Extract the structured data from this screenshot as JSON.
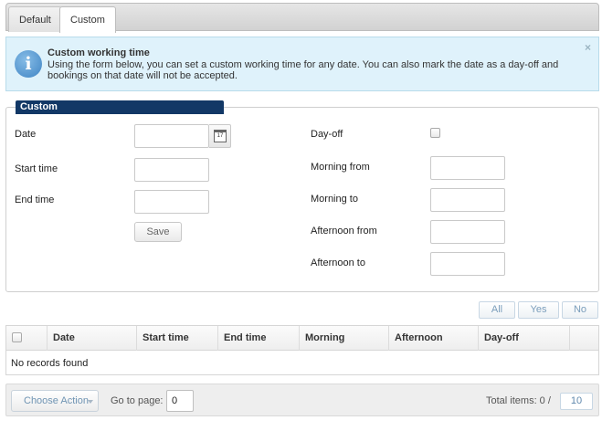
{
  "tabs": [
    {
      "label": "Default",
      "active": false
    },
    {
      "label": "Custom",
      "active": true
    }
  ],
  "info": {
    "icon": "info-icon",
    "title": "Custom working time",
    "text": "Using the form below, you can set a custom working time for any date. You can also mark the date as a day-off and bookings on that date will not be accepted.",
    "close": "×"
  },
  "form": {
    "legend": "Custom",
    "date_label": "Date",
    "date_value": "",
    "calendar_icon_text": "17",
    "start_time_label": "Start time",
    "start_time_value": "",
    "end_time_label": "End time",
    "end_time_value": "",
    "save_label": "Save",
    "day_off_label": "Day-off",
    "day_off_checked": false,
    "morning_from_label": "Morning from",
    "morning_to_label": "Morning to",
    "afternoon_from_label": "Afternoon from",
    "afternoon_to_label": "Afternoon to"
  },
  "filters": [
    "All",
    "Yes",
    "No"
  ],
  "table": {
    "columns": [
      "Date",
      "Start time",
      "End time",
      "Morning",
      "Afternoon",
      "Day-off"
    ],
    "empty_text": "No records found"
  },
  "pager": {
    "action_label": "Choose Action",
    "goto_label": "Go to page:",
    "goto_value": "0",
    "total_label": "Total items: 0 /",
    "page_size": "10"
  },
  "colors": {
    "legend_bg": "#123866",
    "info_bg": "#dff2fb",
    "link_blue": "#5f88ad"
  }
}
